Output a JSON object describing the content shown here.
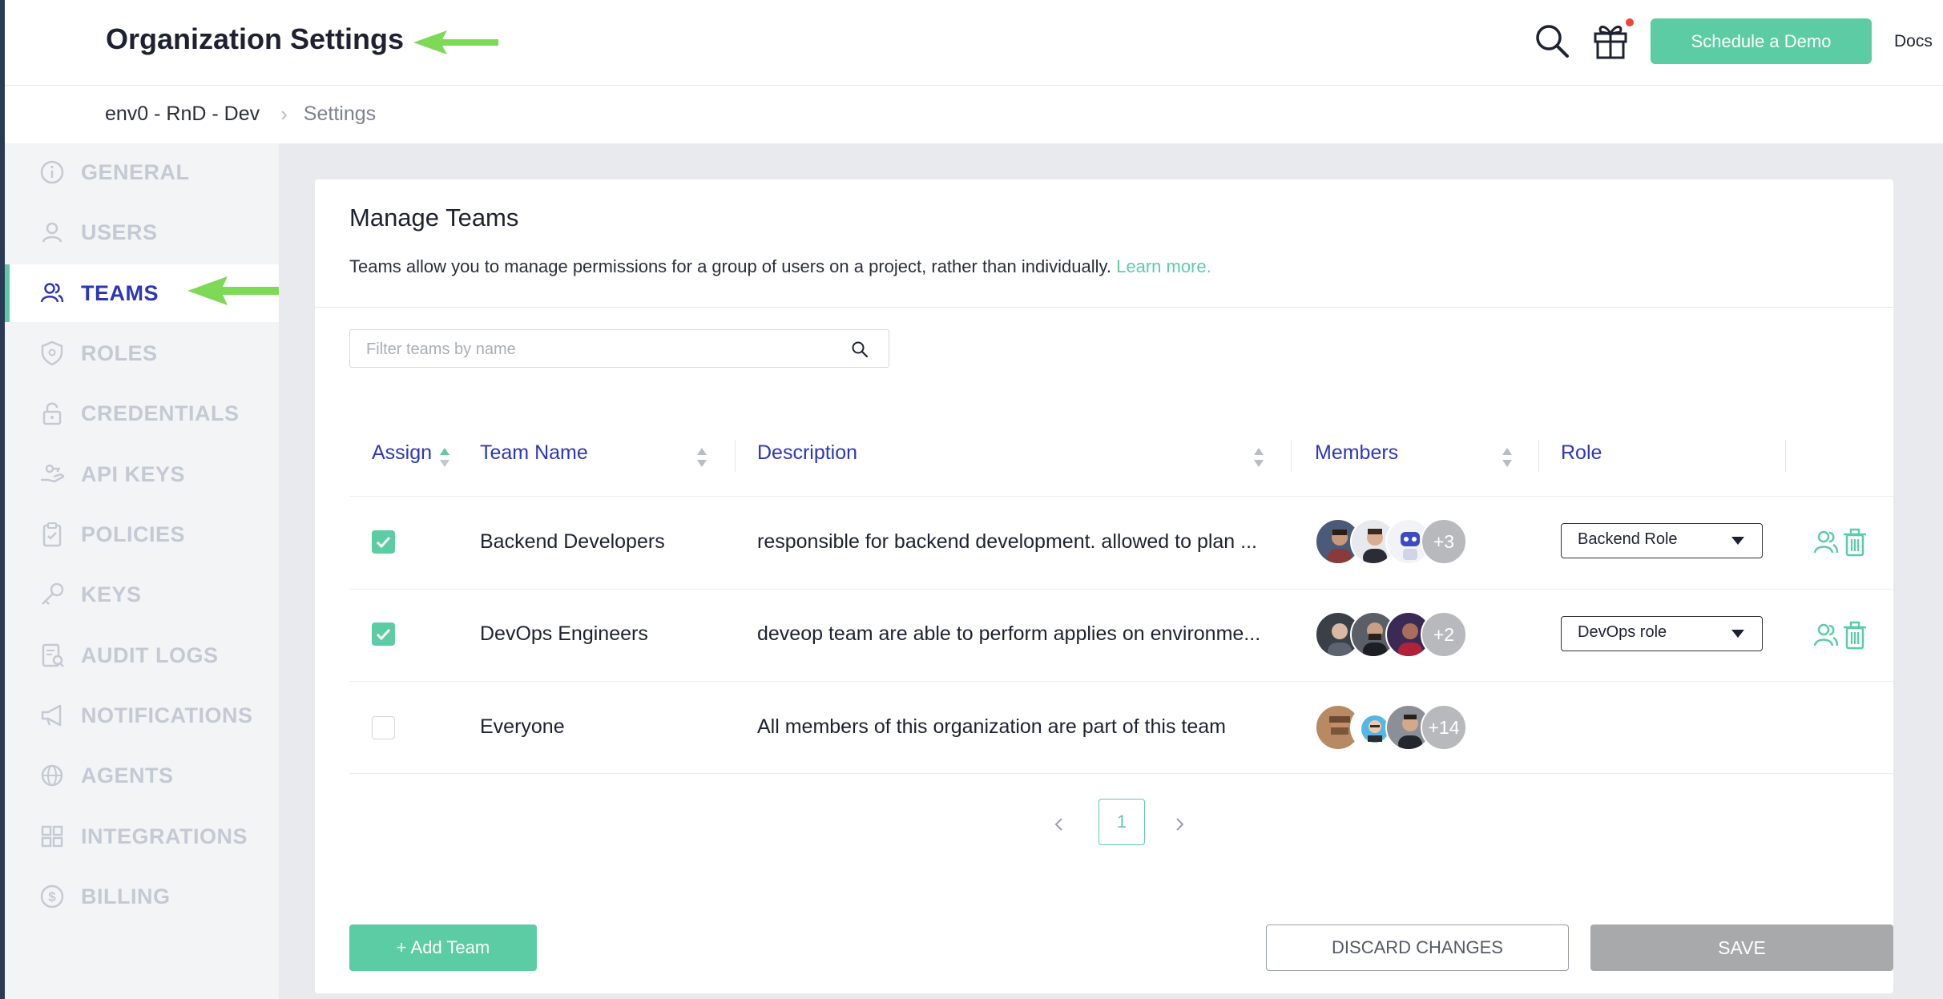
{
  "header": {
    "title": "Organization Settings",
    "demo_button": "Schedule a Demo",
    "docs_link": "Docs"
  },
  "breadcrumb": {
    "org": "env0 - RnD - Dev",
    "current": "Settings"
  },
  "sidebar": {
    "items": [
      {
        "label": "GENERAL",
        "icon": "info-icon"
      },
      {
        "label": "USERS",
        "icon": "user-icon"
      },
      {
        "label": "TEAMS",
        "icon": "team-icon",
        "active": true
      },
      {
        "label": "ROLES",
        "icon": "shield-icon"
      },
      {
        "label": "CREDENTIALS",
        "icon": "lock-icon"
      },
      {
        "label": "API KEYS",
        "icon": "hand-key-icon"
      },
      {
        "label": "POLICIES",
        "icon": "clipboard-icon"
      },
      {
        "label": "KEYS",
        "icon": "key-icon"
      },
      {
        "label": "AUDIT LOGS",
        "icon": "audit-icon"
      },
      {
        "label": "NOTIFICATIONS",
        "icon": "megaphone-icon"
      },
      {
        "label": "AGENTS",
        "icon": "agent-icon"
      },
      {
        "label": "INTEGRATIONS",
        "icon": "grid-icon"
      },
      {
        "label": "BILLING",
        "icon": "dollar-icon"
      }
    ]
  },
  "manage_teams": {
    "title": "Manage Teams",
    "description": "Teams allow you to manage permissions for a group of users on a project, rather than individually.",
    "learn_more": "Learn more.",
    "filter_placeholder": "Filter teams by name",
    "columns": [
      "Assign",
      "Team Name",
      "Description",
      "Members",
      "Role"
    ],
    "rows": [
      {
        "assigned": true,
        "name": "Backend Developers",
        "description": "responsible for backend development. allowed to plan ...",
        "more_members": "+3",
        "role": "Backend Role"
      },
      {
        "assigned": true,
        "name": "DevOps Engineers",
        "description": "deveop team are able to perform applies on environme...",
        "more_members": "+2",
        "role": "DevOps role"
      },
      {
        "assigned": false,
        "name": "Everyone",
        "description": "All members of this organization are part of this team",
        "more_members": "+14",
        "role": ""
      }
    ],
    "pagination": {
      "current_page": "1"
    },
    "add_button": "+ Add Team",
    "discard_button": "DISCARD CHANGES",
    "save_button": "SAVE"
  },
  "colors": {
    "accent": "#5ccca5",
    "link_blue": "#2d36b8",
    "annotation_arrow": "#7ed957"
  }
}
